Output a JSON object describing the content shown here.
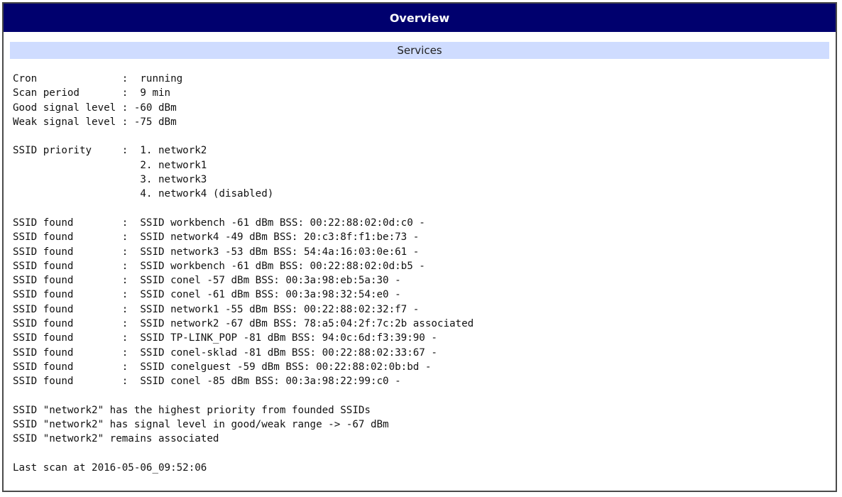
{
  "window": {
    "title": "Overview"
  },
  "section": {
    "title": "Services"
  },
  "log": {
    "lines": [
      "Cron              :  running",
      "Scan period       :  9 min",
      "Good signal level : -60 dBm",
      "Weak signal level : -75 dBm",
      "",
      "SSID priority     :  1. network2",
      "                     2. network1",
      "                     3. network3",
      "                     4. network4 (disabled)",
      "",
      "SSID found        :  SSID workbench -61 dBm BSS: 00:22:88:02:0d:c0 -",
      "SSID found        :  SSID network4 -49 dBm BSS: 20:c3:8f:f1:be:73 -",
      "SSID found        :  SSID network3 -53 dBm BSS: 54:4a:16:03:0e:61 -",
      "SSID found        :  SSID workbench -61 dBm BSS: 00:22:88:02:0d:b5 -",
      "SSID found        :  SSID conel -57 dBm BSS: 00:3a:98:eb:5a:30 -",
      "SSID found        :  SSID conel -61 dBm BSS: 00:3a:98:32:54:e0 -",
      "SSID found        :  SSID network1 -55 dBm BSS: 00:22:88:02:32:f7 -",
      "SSID found        :  SSID network2 -67 dBm BSS: 78:a5:04:2f:7c:2b associated",
      "SSID found        :  SSID TP-LINK_POP -81 dBm BSS: 94:0c:6d:f3:39:90 -",
      "SSID found        :  SSID conel-sklad -81 dBm BSS: 00:22:88:02:33:67 -",
      "SSID found        :  SSID conelguest -59 dBm BSS: 00:22:88:02:0b:bd -",
      "SSID found        :  SSID conel -85 dBm BSS: 00:3a:98:22:99:c0 -",
      "",
      "SSID \"network2\" has the highest priority from founded SSIDs",
      "SSID \"network2\" has signal level in good/weak range -> -67 dBm",
      "SSID \"network2\" remains associated",
      "",
      "Last scan at 2016-05-06_09:52:06"
    ]
  }
}
